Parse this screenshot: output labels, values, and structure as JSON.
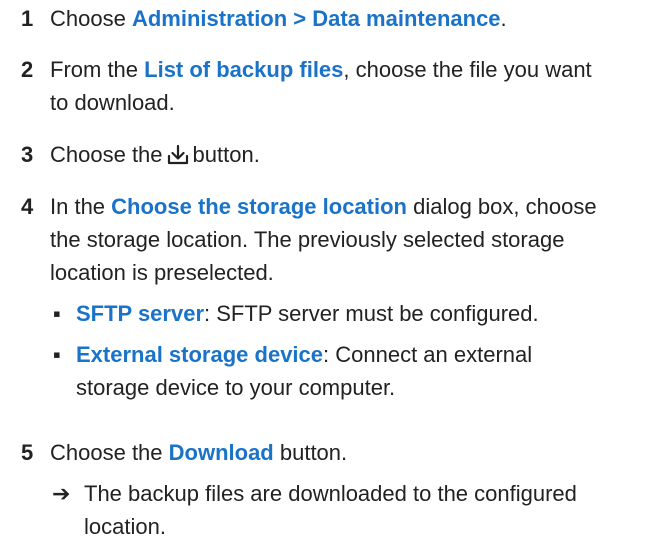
{
  "steps": [
    {
      "num": "1",
      "pre": "Choose ",
      "hl1": "Administration > Data maintenance",
      "post": "."
    },
    {
      "num": "2",
      "pre": "From the ",
      "hl1": "List of backup files",
      "post": ", choose the file you want to download."
    },
    {
      "num": "3",
      "pre": "Choose the",
      "icon": "download-icon",
      "post": "button."
    },
    {
      "num": "4",
      "pre": "In the ",
      "hl1": "Choose the storage location",
      "post": " dialog box, choose the storage location. The previously selected storage location is preselected.",
      "options": [
        {
          "hl": "SFTP server",
          "text": ": SFTP server must be configured."
        },
        {
          "hl": "External storage device",
          "text": ": Connect an external storage device to your computer."
        }
      ]
    },
    {
      "num": "5",
      "pre": "Choose the ",
      "hl1": "Download",
      "post": " button.",
      "result": "The backup files are downloaded to the configured location."
    }
  ],
  "colors": {
    "highlight": "#1a73c8",
    "text": "#222222"
  }
}
